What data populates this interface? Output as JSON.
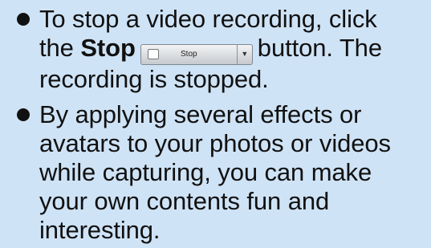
{
  "items": [
    {
      "lines": [
        "To stop a video recording, click",
        "the",
        "Stop",
        "button. The",
        "recording is stopped."
      ],
      "button": {
        "label": "Stop",
        "icon": "stop-square-icon",
        "dropdown_icon": "chevron-down-icon"
      }
    },
    {
      "lines": [
        "By applying several effects or",
        "avatars to your photos or videos",
        "while capturing, you can make",
        "your own contents fun and",
        "interesting."
      ]
    }
  ],
  "colors": {
    "background": "#cfe3f6",
    "text": "#111111"
  }
}
